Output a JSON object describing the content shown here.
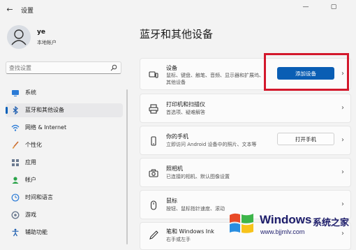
{
  "window": {
    "title": "设置",
    "back_glyph": "←",
    "min_glyph": "—",
    "max_glyph": "▢"
  },
  "user": {
    "name": "ye",
    "account_type": "本地帐户"
  },
  "search": {
    "placeholder": "查找设置"
  },
  "sidebar": {
    "items": [
      {
        "label": "系统",
        "icon": "monitor-icon"
      },
      {
        "label": "蓝牙和其他设备",
        "icon": "bluetooth-icon",
        "selected": true
      },
      {
        "label": "网络 & Internet",
        "icon": "wifi-icon"
      },
      {
        "label": "个性化",
        "icon": "brush-icon"
      },
      {
        "label": "应用",
        "icon": "apps-icon"
      },
      {
        "label": "帐户",
        "icon": "person-icon"
      },
      {
        "label": "时间和语言",
        "icon": "globe-clock-icon"
      },
      {
        "label": "游戏",
        "icon": "gamepad-icon"
      },
      {
        "label": "辅助功能",
        "icon": "accessibility-icon"
      }
    ]
  },
  "main": {
    "title": "蓝牙和其他设备",
    "cards": [
      {
        "title": "设备",
        "desc": "鼠标、键盘、触笔、音频、显示器和扩展坞、其他设备",
        "button": "添加设备",
        "icon": "devices-icon"
      },
      {
        "title": "打印机和扫描仪",
        "desc": "首选项、疑难解答",
        "icon": "printer-icon"
      },
      {
        "title": "你的手机",
        "desc": "立即访问 Android 设备中的照片、文本等",
        "button": "打开手机",
        "icon": "phone-icon"
      },
      {
        "title": "照相机",
        "desc": "已连接的相机、默认图像设置",
        "icon": "camera-icon"
      },
      {
        "title": "鼠标",
        "desc": "按钮、鼠标指针速度、滚动",
        "icon": "mouse-icon"
      },
      {
        "title": "笔和 Windows Ink",
        "desc": "右手或左手",
        "icon": "pen-icon"
      }
    ],
    "chevron": "›"
  },
  "watermark": {
    "brand": "Windows",
    "site": "www.bjjmlv.com",
    "cn": "系统之家"
  },
  "colors": {
    "accent": "#0a5eb4",
    "highlight": "#d3182c",
    "background": "#f3f3f3"
  }
}
